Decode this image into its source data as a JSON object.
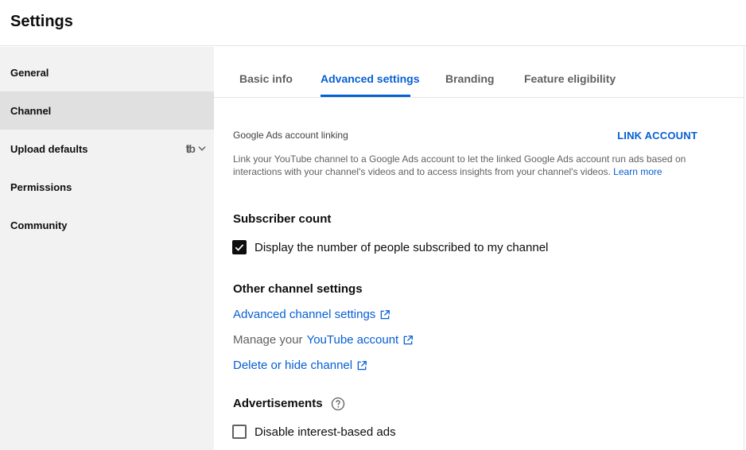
{
  "header": {
    "title": "Settings"
  },
  "sidebar": {
    "items": [
      {
        "label": "General"
      },
      {
        "label": "Channel"
      },
      {
        "label": "Upload defaults"
      },
      {
        "label": "Permissions"
      },
      {
        "label": "Community"
      }
    ],
    "active_index": 1
  },
  "tabs": {
    "items": [
      {
        "label": "Basic info"
      },
      {
        "label": "Advanced settings"
      },
      {
        "label": "Branding"
      },
      {
        "label": "Feature eligibility"
      }
    ],
    "active_index": 1
  },
  "ads": {
    "label": "Google Ads account linking",
    "link_account": "LINK ACCOUNT",
    "description": "Link your YouTube channel to a Google Ads account to let the linked Google Ads account run ads based on interactions with your channel's videos and to access insights from your channel's videos.",
    "learn_more": "Learn more"
  },
  "subscriber": {
    "title": "Subscriber count",
    "checkbox_label": "Display the number of people subscribed to my channel",
    "checked": true
  },
  "other": {
    "title": "Other channel settings",
    "advanced_link": "Advanced channel settings",
    "manage_prefix": "Manage your",
    "youtube_account_link": "YouTube account",
    "delete_link": "Delete or hide channel"
  },
  "advertisements": {
    "title": "Advertisements",
    "checkbox_label": "Disable interest-based ads",
    "checked": false
  },
  "colors": {
    "accent": "#065fd4",
    "sidebar_bg": "#f2f2f2",
    "sidebar_active_bg": "#e0e0e0"
  }
}
